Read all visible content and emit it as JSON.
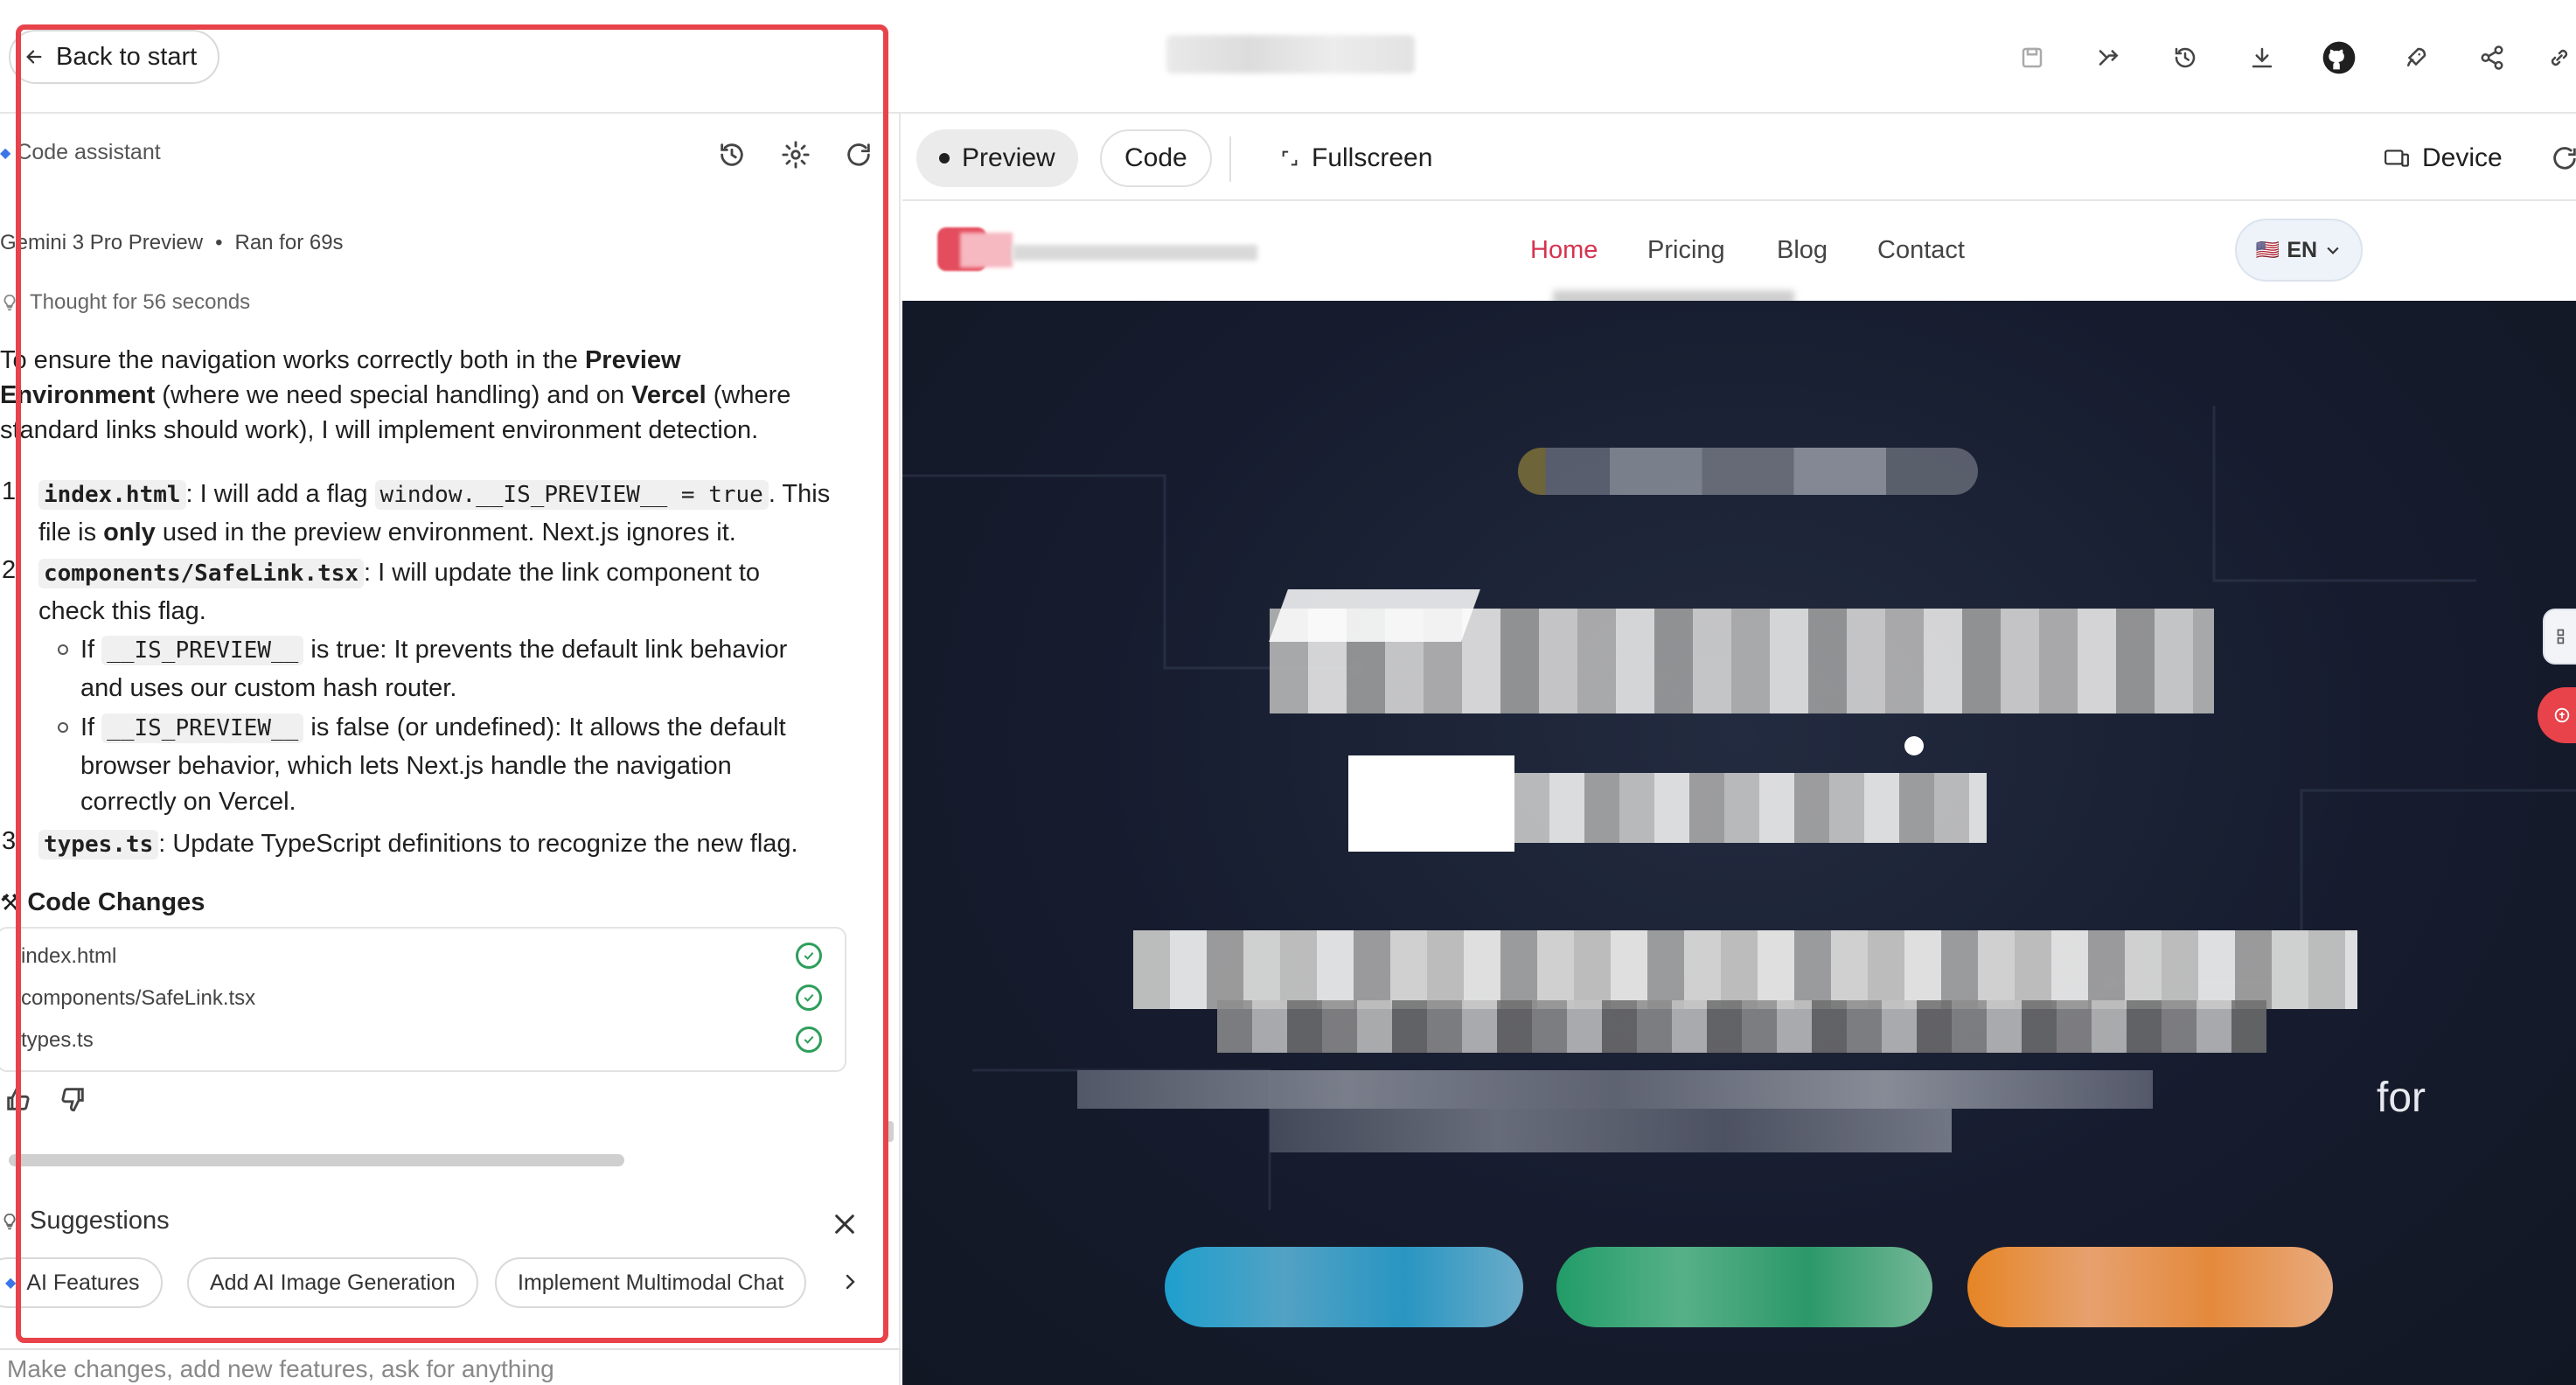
{
  "topbar": {
    "back_label": "Back to start",
    "icons": [
      "save-icon",
      "branch-icon",
      "history-icon",
      "download-icon",
      "github-icon",
      "rocket-icon",
      "share-icon",
      "link-icon"
    ]
  },
  "chat": {
    "assistant_label": "Code assistant",
    "model": "Gemini 3 Pro Preview",
    "run_time": "Ran for 69s",
    "thought": "Thought for 56 seconds",
    "intro": {
      "p1": "To ensure the navigation works correctly both in the ",
      "b1": "Preview Environment",
      "p2": " (where we need special handling) and on ",
      "b2": "Vercel",
      "p3": " (where standard links should work), I will implement environment detection."
    },
    "steps": [
      {
        "num": "1.",
        "code": "index.html",
        "t1": ": I will add a flag ",
        "code2": "window.__IS_PREVIEW__ = true",
        "t2": ". This",
        "t3": "file is ",
        "bold": "only",
        "t4": " used in the preview environment. Next.js ignores it."
      },
      {
        "num": "2.",
        "code": "components/SafeLink.tsx",
        "t1": ": I will update the link component to",
        "t2": "check this flag."
      },
      {
        "num": "3.",
        "code": "types.ts",
        "t1": ": Update TypeScript definitions to recognize the new flag."
      }
    ],
    "sub_bullets": [
      {
        "lead": "If ",
        "code": "__IS_PREVIEW__",
        "t1": " is true: It prevents the default link behavior",
        "t2": "and uses our custom hash router."
      },
      {
        "lead": "If ",
        "code": "__IS_PREVIEW__",
        "t1": " is false (or undefined): It allows the default",
        "t2": "browser behavior, which lets Next.js handle the navigation",
        "t3": "correctly on Vercel."
      }
    ],
    "changes_title": "Code Changes",
    "changes": [
      "index.html",
      "components/SafeLink.tsx",
      "types.ts"
    ],
    "suggestions_title": "Suggestions",
    "suggestions": [
      "AI Features",
      "Add AI Image Generation",
      "Implement Multimodal Chat"
    ],
    "prompt_placeholder": "Make changes, add new features, ask for anything"
  },
  "preview": {
    "tabs": {
      "preview": "Preview",
      "code": "Code",
      "fullscreen": "Fullscreen",
      "device": "Device"
    },
    "nav": {
      "home": "Home",
      "pricing": "Pricing",
      "blog": "Blog",
      "contact": "Contact",
      "lang": "EN",
      "flag": "🇺🇸"
    },
    "hero_tail": "for",
    "colors": {
      "accent": "#d6334f",
      "hero_bg": "#161c2e",
      "btn_blue": "#1fa6d6",
      "btn_green": "#22a36b",
      "btn_orange": "#f08a24",
      "frame_red": "#e8434a"
    }
  }
}
